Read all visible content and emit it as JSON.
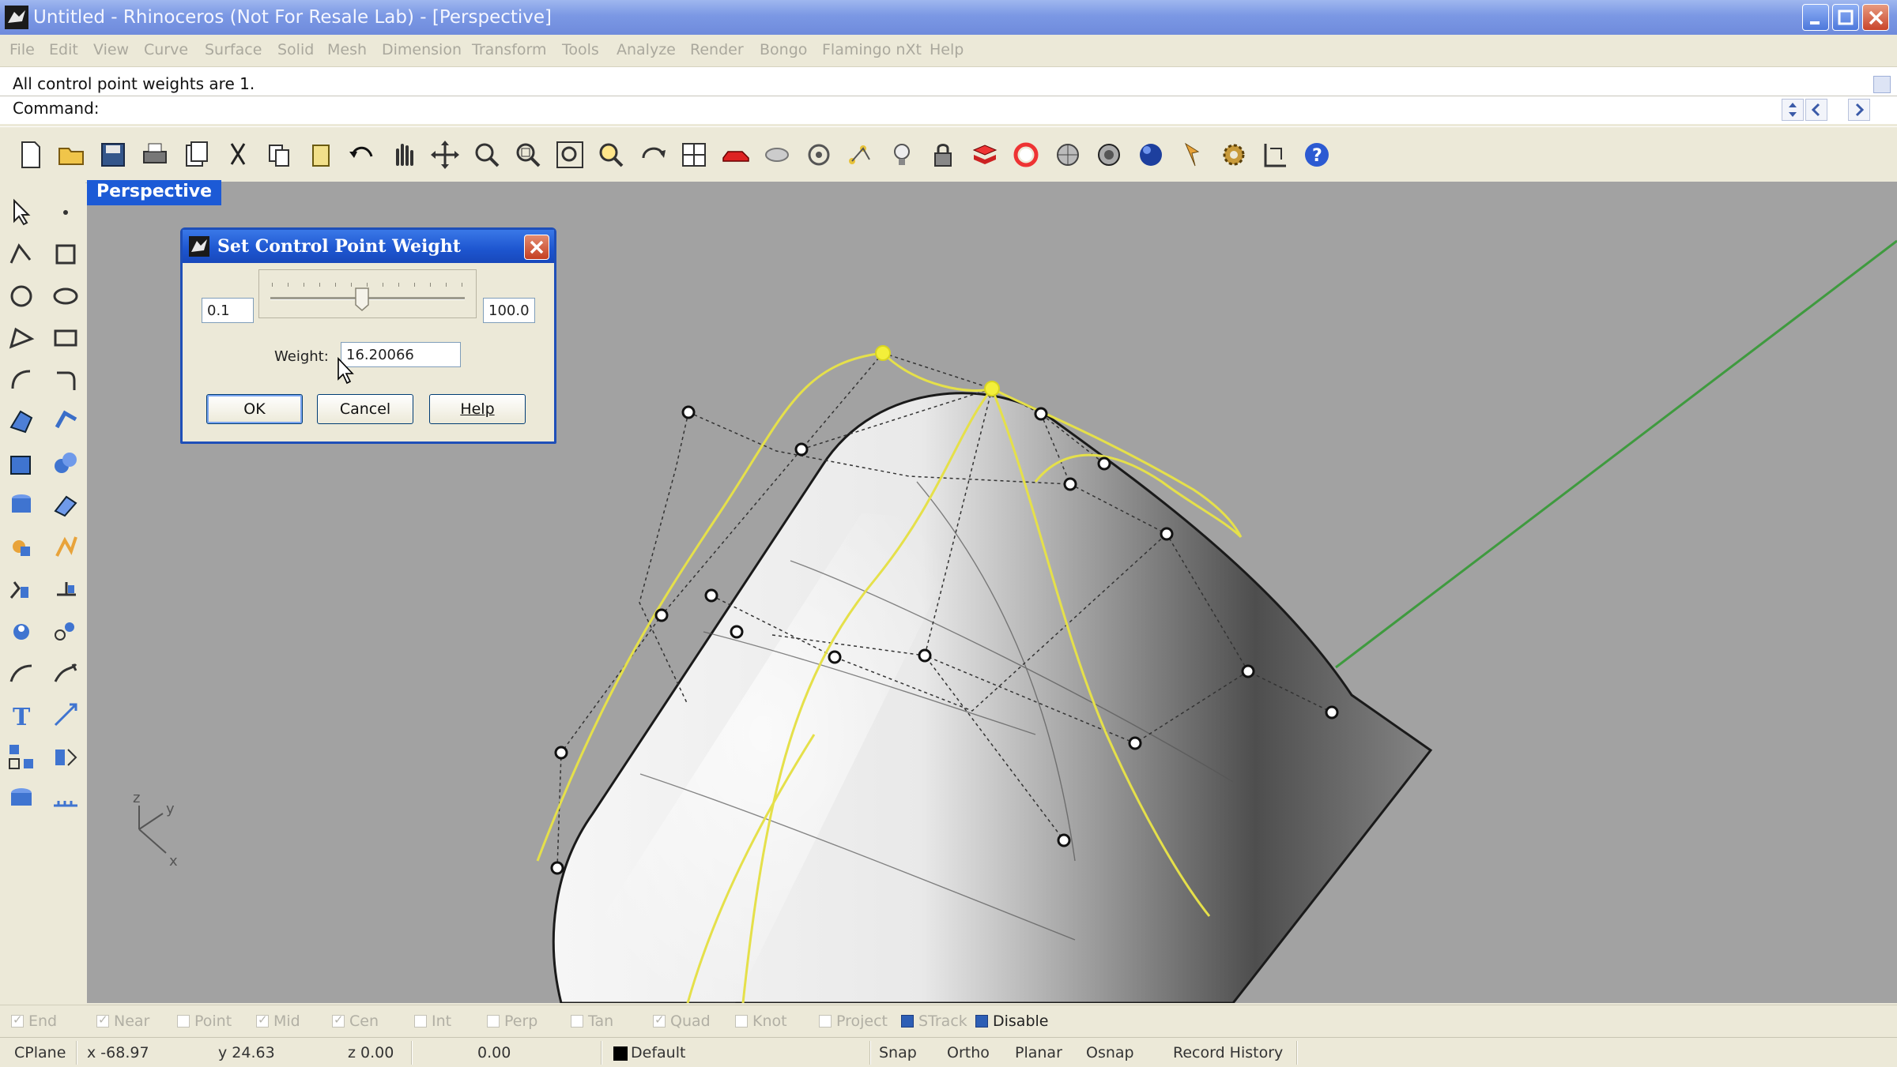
{
  "window": {
    "title": "Untitled - Rhinoceros (Not For Resale Lab) - [Perspective]"
  },
  "menu": [
    "File",
    "Edit",
    "View",
    "Curve",
    "Surface",
    "Solid",
    "Mesh",
    "Dimension",
    "Transform",
    "Tools",
    "Analyze",
    "Render",
    "Bongo",
    "Flamingo nXt",
    "Help"
  ],
  "command": {
    "history": "All control point weights are 1.",
    "prompt": "Command:"
  },
  "toolbar_icons": [
    "new-icon",
    "open-icon",
    "save-icon",
    "print-icon",
    "import-icon",
    "cut-icon",
    "copy-icon",
    "paste-icon",
    "undo-icon",
    "pan-icon",
    "move-icon",
    "zoom-icon",
    "zoom-window-icon",
    "zoom-extents-icon",
    "zoom-selected-icon",
    "rotate-view-icon",
    "four-viewports-icon",
    "car-icon",
    "hide-icon",
    "show-icon",
    "points-icon",
    "light-icon",
    "lock-icon",
    "layer-icon",
    "color-icon",
    "render-preview-icon",
    "render-settings-icon",
    "sphere-render-icon",
    "flamingo-icon",
    "options-gear-icon",
    "dimension-icon",
    "help-icon"
  ],
  "viewport": {
    "tab_label": "Perspective",
    "axes": {
      "z": "z",
      "y": "y",
      "x": "x"
    }
  },
  "dialog": {
    "title": "Set Control Point Weight",
    "min_value": "0.1",
    "max_value": "100.0",
    "weight_label": "Weight:",
    "weight_value": "16.20066",
    "slider_fraction": 0.47,
    "ok_label": "OK",
    "cancel_label": "Cancel",
    "help_label": "Help"
  },
  "osnaps": [
    {
      "label": "End",
      "checked": true
    },
    {
      "label": "Near",
      "checked": true
    },
    {
      "label": "Point",
      "checked": false
    },
    {
      "label": "Mid",
      "checked": true
    },
    {
      "label": "Cen",
      "checked": true
    },
    {
      "label": "Int",
      "checked": false
    },
    {
      "label": "Perp",
      "checked": false
    },
    {
      "label": "Tan",
      "checked": false
    },
    {
      "label": "Quad",
      "checked": true
    },
    {
      "label": "Knot",
      "checked": false
    },
    {
      "label": "Project",
      "checked": false
    },
    {
      "label": "STrack",
      "checked": true
    },
    {
      "label": "Disable",
      "checked": true
    }
  ],
  "status": {
    "cplane": "CPlane",
    "x": "x -68.97",
    "y": "y 24.63",
    "z": "z 0.00",
    "distance": "0.00",
    "layer": "Default",
    "snap": "Snap",
    "ortho": "Ortho",
    "planar": "Planar",
    "osnap": "Osnap",
    "record_history": "Record History"
  }
}
